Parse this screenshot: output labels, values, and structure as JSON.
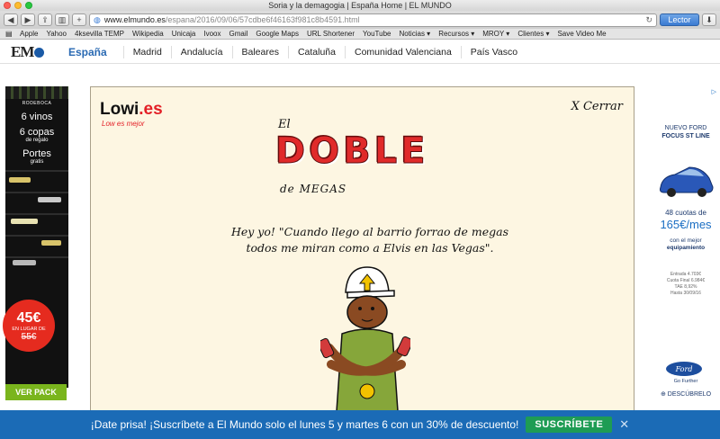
{
  "window": {
    "title": "Soria y la demagogia | España Home | EL MUNDO"
  },
  "toolbar": {
    "url_domain": "www.elmundo.es",
    "url_path": "/espana/2016/09/06/57cdbe6f46163f981c8b4591.html",
    "reader_label": "Lector"
  },
  "bookmarks": [
    "Apple",
    "Yahoo",
    "4ksevilla TEMP",
    "Wikipedia",
    "Unicaja",
    "Ivoox",
    "Gmail",
    "Google Maps",
    "URL Shortener",
    "YouTube",
    "Noticias ▾",
    "Recursos ▾",
    "MROY ▾",
    "Clientes ▾",
    "Save Video Me"
  ],
  "site": {
    "logo": "EM",
    "section": "España",
    "nav": [
      "Madrid",
      "Andalucía",
      "Baleares",
      "Cataluña",
      "Comunidad Valenciana",
      "País Vasco"
    ]
  },
  "left_ad": {
    "brand": "RODEBOCA",
    "line1": "6 vinos",
    "line2": "6 copas",
    "line2_small": "de regalo",
    "line3": "Portes",
    "line3_small": "gratis",
    "price": "45€",
    "price_note": "EN LUGAR DE",
    "old_price": "55€",
    "cta": "VER PACK"
  },
  "modal": {
    "brand": "Lowi",
    "brand_suffix": ".es",
    "tagline": "Low es mejor",
    "close_label": "X Cerrar",
    "el": "El",
    "doble_letters": [
      "D",
      "O",
      "B",
      "L",
      "E"
    ],
    "megas": "de MEGAS",
    "quote_line1": "Hey yo! \"Cuando llego al barrio forrao de megas",
    "quote_line2": "todos me miran como a Elvis en las Vegas\"."
  },
  "right_ad": {
    "adchoice": "▷",
    "title_line1": "NUEVO FORD",
    "title_line2": "FOCUS ST LINE",
    "cuotas": "48 cuotas de",
    "price": "165€/mes",
    "equip_line1": "con el mejor",
    "equip_line2": "equipamiento",
    "legal1": "Entrada 4.703€",
    "legal2": "Cuota Final 6.984€",
    "legal3": "TAE 8,92%",
    "legal4": "Hasta 30/09/16",
    "logo": "Ford",
    "go_further": "Go Further",
    "descubrelo": "⊕ DESCÚBRELO"
  },
  "banner": {
    "text": "¡Date prisa! ¡Suscríbete a El Mundo solo el lunes 5 y martes 6 con un 30% de descuento!",
    "cta": "SUSCRÍBETE",
    "close": "✕"
  }
}
